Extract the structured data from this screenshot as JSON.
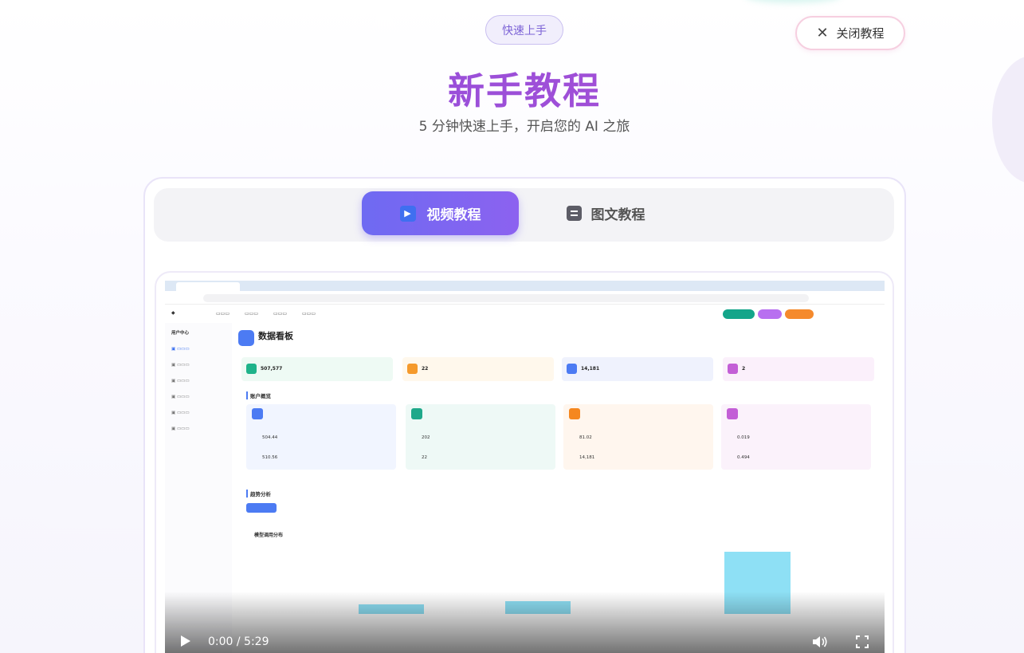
{
  "header": {
    "badge": "快速上手",
    "close_label": "关闭教程",
    "title": "新手教程",
    "subtitle": "5 分钟快速上手，开启您的 AI 之旅"
  },
  "tabs": [
    {
      "label": "视频教程",
      "active": true,
      "icon": "play-icon"
    },
    {
      "label": "图文教程",
      "active": false,
      "icon": "document-icon"
    }
  ],
  "video": {
    "current_time": "0:00",
    "duration": "5:29",
    "time_display": "0:00 / 5:29",
    "frame": {
      "dashboard_title": "数据看板",
      "sidebar_header": "用户中心",
      "section_account": "账户概览",
      "section_trend": "趋势分析",
      "chart_title": "模型调用分布",
      "stats": [
        "507,577",
        "22",
        "14,181",
        "2"
      ],
      "account_cards": [
        {
          "n1": "504.44",
          "n2": "510.56"
        },
        {
          "n1": "202",
          "n2": "22"
        },
        {
          "n1": "81.02",
          "n2": "14,181"
        },
        {
          "n1": "0.019",
          "n2": "0.494"
        }
      ]
    }
  },
  "colors": {
    "accent": "#7b66f1",
    "title_gradient_start": "#8a4fe0",
    "title_gradient_end": "#b04fd0"
  }
}
